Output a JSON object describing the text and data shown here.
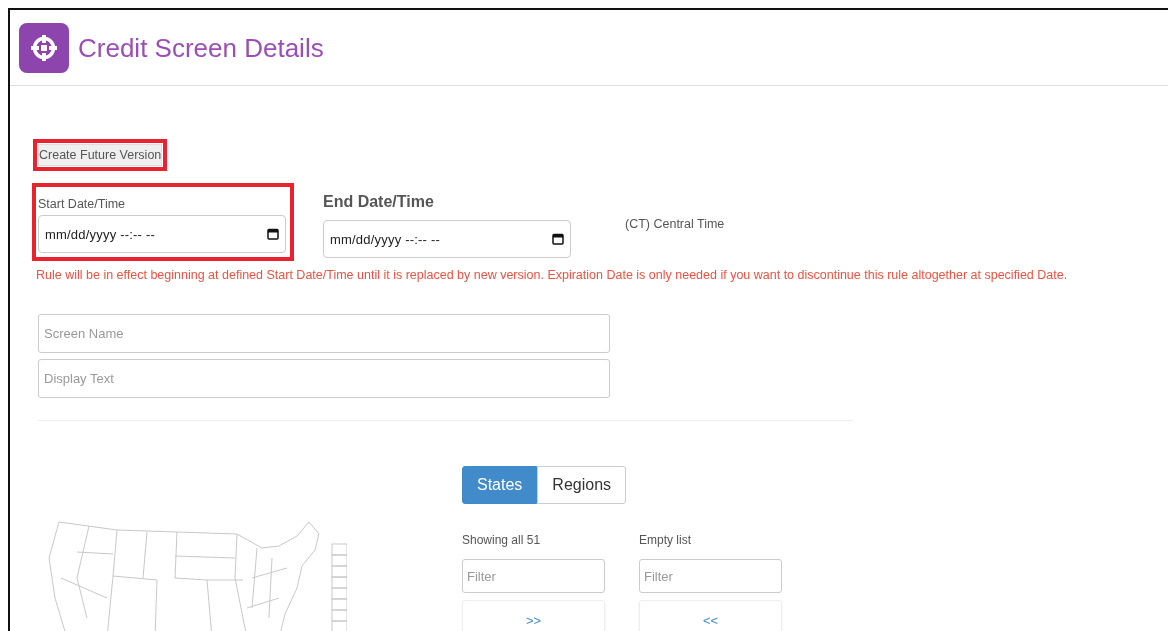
{
  "header": {
    "title": "Credit Screen Details"
  },
  "future_version_button": {
    "label": "Create Future Version",
    "highlighted": true
  },
  "start": {
    "label": "Start Date/Time",
    "placeholder": "mm/dd/yyyy --:-- --",
    "highlighted": true
  },
  "end": {
    "label": "End Date/Time",
    "placeholder": "mm/dd/yyyy --:-- --",
    "highlighted": false
  },
  "timezone": "(CT) Central Time",
  "notice": "Rule will be in effect beginning at defined Start Date/Time until it is replaced by new version. Expiration Date is only needed if you want to discontinue this rule altogether at specified Date.",
  "fields": [
    {
      "placeholder": "Screen Name"
    },
    {
      "placeholder": "Display Text"
    }
  ],
  "tabs": [
    {
      "label": "States",
      "selected": true
    },
    {
      "label": "Regions",
      "selected": false
    }
  ],
  "lists": [
    {
      "caption": "Showing all 51",
      "filter_placeholder": "Filter",
      "move_button": ">>"
    },
    {
      "caption": "Empty list",
      "filter_placeholder": "Filter",
      "move_button": "<<"
    }
  ]
}
